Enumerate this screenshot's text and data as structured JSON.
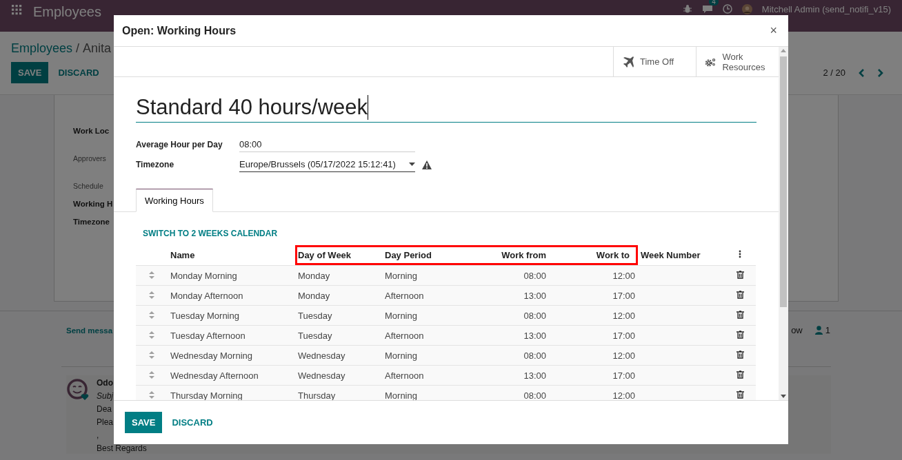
{
  "top_bar": {
    "app_name": "Employees",
    "chat_badge": "4",
    "user": "Mitchell Admin (send_notifi_v15)"
  },
  "background": {
    "breadcrumb": {
      "parent": "Employees",
      "separator": "/",
      "current": "Anita"
    },
    "buttons": [
      "SAVE",
      "DISCARD"
    ],
    "pager": "2 / 20",
    "form_labels": [
      {
        "kind": "field",
        "text": "Work Loc"
      },
      {
        "kind": "section",
        "text": "Approvers"
      },
      {
        "kind": "section",
        "text": "Schedule"
      },
      {
        "kind": "field",
        "text": "Working H"
      },
      {
        "kind": "field",
        "text": "Timezone"
      }
    ],
    "chatter": {
      "send_message": "Send messa",
      "follow": "ow",
      "followers": "1",
      "message": {
        "author": "Odo",
        "subject": "Subj",
        "lines": [
          "Dea",
          "Plea",
          ",",
          "Best Regards"
        ]
      }
    }
  },
  "dialog": {
    "title": "Open: Working Hours",
    "close": "×",
    "smart_buttons": [
      {
        "label": "Time Off"
      },
      {
        "label": "Work Resources"
      }
    ],
    "record_name": "Standard 40 hours/week",
    "fields": [
      {
        "kind": "input",
        "label": "Average Hour per Day",
        "value": "08:00"
      },
      {
        "kind": "select",
        "label": "Timezone",
        "value": "Europe/Brussels (05/17/2022 15:12:41)",
        "warning": true
      }
    ],
    "tabs": [
      {
        "label": "Working Hours",
        "selected": true
      }
    ],
    "link": "SWITCH TO 2 WEEKS CALENDAR",
    "table": {
      "columns": [
        {
          "label": "Name",
          "highlighted": false
        },
        {
          "label": "Day of Week",
          "highlighted": true
        },
        {
          "label": "Day Period",
          "highlighted": true
        },
        {
          "label": "Work from",
          "highlighted": true
        },
        {
          "label": "Work to",
          "highlighted": true
        },
        {
          "label": "Week Number",
          "highlighted": false
        }
      ],
      "rows": [
        [
          "Monday Morning",
          "Monday",
          "Morning",
          "08:00",
          "12:00"
        ],
        [
          "Monday Afternoon",
          "Monday",
          "Afternoon",
          "13:00",
          "17:00"
        ],
        [
          "Tuesday Morning",
          "Tuesday",
          "Morning",
          "08:00",
          "12:00"
        ],
        [
          "Tuesday Afternoon",
          "Tuesday",
          "Afternoon",
          "13:00",
          "17:00"
        ],
        [
          "Wednesday Morning",
          "Wednesday",
          "Morning",
          "08:00",
          "12:00"
        ],
        [
          "Wednesday Afternoon",
          "Wednesday",
          "Afternoon",
          "13:00",
          "17:00"
        ],
        [
          "Thursday Morning",
          "Thursday",
          "Morning",
          "08:00",
          "12:00"
        ]
      ]
    },
    "footer_buttons": [
      "SAVE",
      "DISCARD"
    ]
  }
}
